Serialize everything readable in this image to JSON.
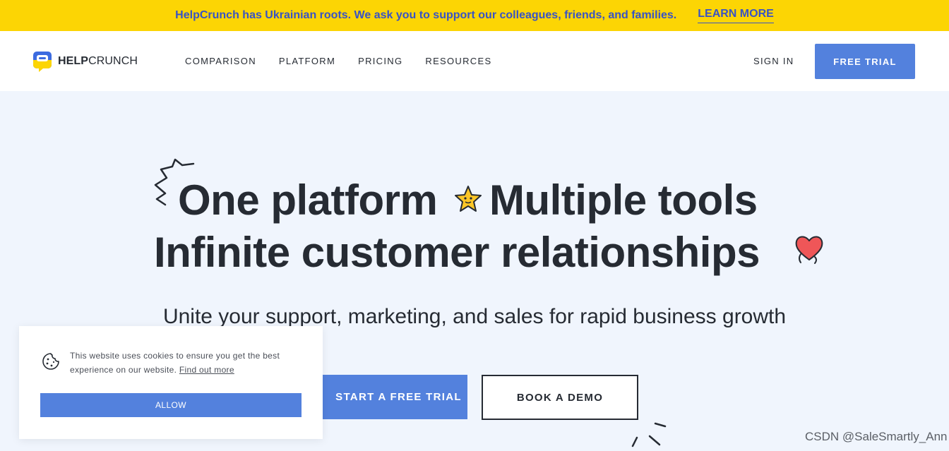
{
  "banner": {
    "text": "HelpCrunch has Ukrainian roots.  We ask you to support our colleagues, friends, and families.",
    "link": "LEARN MORE"
  },
  "nav": {
    "logo_bold": "HELP",
    "logo_light": "CRUNCH",
    "items": [
      "COMPARISON",
      "PLATFORM",
      "PRICING",
      "RESOURCES"
    ],
    "sign_in": "SIGN IN",
    "free_trial": "FREE TRIAL"
  },
  "hero": {
    "line1a": "One platform",
    "line1b": "Multiple tools",
    "line2": "Infinite customer relationships",
    "subtitle": "Unite your support, marketing, and sales for rapid business growth",
    "cta_primary": "START A FREE TRIAL",
    "cta_secondary": "BOOK A DEMO"
  },
  "cookie": {
    "text": "This website uses cookies to ensure you get the best experience on our website.",
    "link": "Find out more",
    "allow": "ALLOW"
  },
  "watermark": "CSDN @SaleSmartly_Ann",
  "colors": {
    "banner_bg": "#fcd504",
    "banner_text": "#3853c5",
    "primary": "#5381dd",
    "hero_bg": "#f0f5fd",
    "star": "#fcc626",
    "heart": "#ef5658"
  },
  "icons": [
    "logo-icon",
    "squiggle-icon",
    "star-icon",
    "heart-icon",
    "cookie-icon",
    "spark-icon"
  ]
}
